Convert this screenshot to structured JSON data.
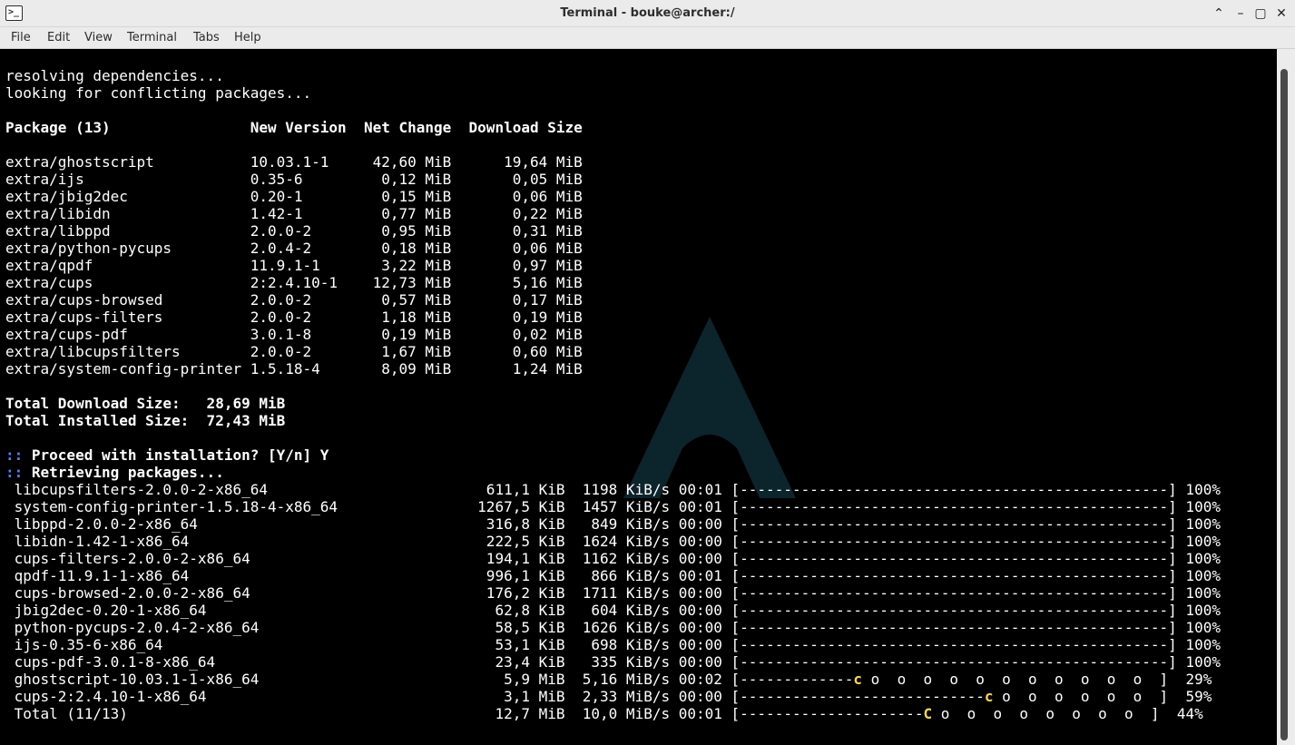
{
  "window": {
    "title": "Terminal - bouke@archer:/",
    "app_icon_glyph": ">_",
    "controls": {
      "keep_above": "⌃",
      "minimize": "–",
      "maximize": "▢",
      "close": "✕"
    }
  },
  "menu": [
    "File",
    "Edit",
    "View",
    "Terminal",
    "Tabs",
    "Help"
  ],
  "terminal": {
    "lines": [
      "resolving dependencies...",
      "looking for conflicting packages...",
      "",
      "Package (13)                New Version  Net Change  Download Size",
      "",
      "extra/ghostscript           10.03.1-1     42,60 MiB      19,64 MiB",
      "extra/ijs                   0.35-6         0,12 MiB       0,05 MiB",
      "extra/jbig2dec              0.20-1         0,15 MiB       0,06 MiB",
      "extra/libidn                1.42-1         0,77 MiB       0,22 MiB",
      "extra/libppd                2.0.0-2        0,95 MiB       0,31 MiB",
      "extra/python-pycups         2.0.4-2        0,18 MiB       0,06 MiB",
      "extra/qpdf                  11.9.1-1       3,22 MiB       0,97 MiB",
      "extra/cups                  2:2.4.10-1    12,73 MiB       5,16 MiB",
      "extra/cups-browsed          2.0.0-2        0,57 MiB       0,17 MiB",
      "extra/cups-filters          2.0.0-2        1,18 MiB       0,19 MiB",
      "extra/cups-pdf              3.0.1-8        0,19 MiB       0,02 MiB",
      "extra/libcupsfilters        2.0.0-2        1,67 MiB       0,60 MiB",
      "extra/system-config-printer 1.5.18-4       8,09 MiB       1,24 MiB",
      "",
      "Total Download Size:   28,69 MiB",
      "Total Installed Size:  72,43 MiB",
      "",
      ":: Proceed with installation? [Y/n] Y",
      ":: Retrieving packages...",
      " libcupsfilters-2.0.0-2-x86_64                         611,1 KiB  1198 KiB/s 00:01 [-------------------------------------------------] 100%",
      " system-config-printer-1.5.18-4-x86_64                1267,5 KiB  1457 KiB/s 00:01 [-------------------------------------------------] 100%",
      " libppd-2.0.0-2-x86_64                                 316,8 KiB   849 KiB/s 00:00 [-------------------------------------------------] 100%",
      " libidn-1.42-1-x86_64                                  222,5 KiB  1624 KiB/s 00:00 [-------------------------------------------------] 100%",
      " cups-filters-2.0.0-2-x86_64                           194,1 KiB  1162 KiB/s 00:00 [-------------------------------------------------] 100%",
      " qpdf-11.9.1-1-x86_64                                  996,1 KiB   866 KiB/s 00:01 [-------------------------------------------------] 100%",
      " cups-browsed-2.0.0-2-x86_64                           176,2 KiB  1711 KiB/s 00:00 [-------------------------------------------------] 100%",
      " jbig2dec-0.20-1-x86_64                                 62,8 KiB   604 KiB/s 00:00 [-------------------------------------------------] 100%",
      " python-pycups-2.0.4-2-x86_64                           58,5 KiB  1626 KiB/s 00:00 [-------------------------------------------------] 100%",
      " ijs-0.35-6-x86_64                                      53,1 KiB   698 KiB/s 00:00 [-------------------------------------------------] 100%",
      " cups-pdf-3.0.1-8-x86_64                                23,4 KiB   335 KiB/s 00:00 [-------------------------------------------------] 100%",
      " ghostscript-10.03.1-1-x86_64                            5,9 MiB  5,16 MiB/s 00:02 [-------------c o  o  o  o  o  o  o  o  o  o  o  ]  29%",
      " cups-2:2.4.10-1-x86_64                                  3,1 MiB  2,33 MiB/s 00:00 [----------------------------c o  o  o  o  o  o  ]  59%",
      " Total (11/13)                                          12,7 MiB  10,0 MiB/s 00:01 [---------------------C o  o  o  o  o  o  o  o  ]  44%"
    ]
  },
  "colors": {
    "background": "#000000",
    "foreground": "#ffffff",
    "prompt_marker": "#5d7bff",
    "pacman_chomp": "#ffd84a",
    "chrome": "#ebebeb"
  }
}
